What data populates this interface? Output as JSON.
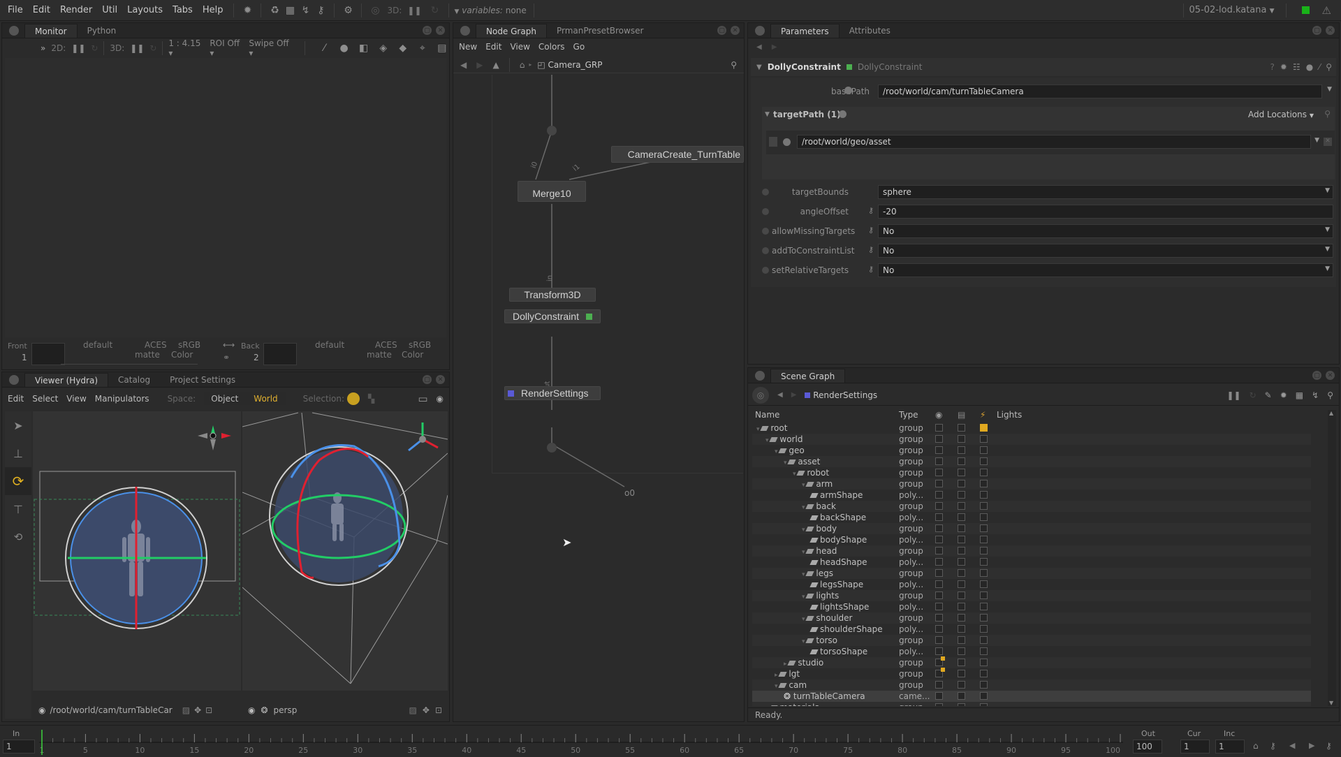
{
  "menubar": {
    "items": [
      "File",
      "Edit",
      "Render",
      "Util",
      "Layouts",
      "Tabs",
      "Help"
    ],
    "mode_3d": "3D:",
    "variables_label": "variables:",
    "variables_value": "none",
    "project_file": "05-02-lod.katana",
    "status_color": "#19b219"
  },
  "monitor": {
    "tabs": [
      "Monitor",
      "Python"
    ],
    "toolbar": {
      "mode_2d": "2D:",
      "mode_3d": "3D:",
      "zoom": "1 : 4.15",
      "roi": "ROI Off",
      "swipe": "Swipe Off"
    },
    "front": {
      "label": "Front",
      "index": "1",
      "channel": "default",
      "colorspace": "ACES",
      "display": "sRGB",
      "matte": "matte",
      "color": "Color"
    },
    "back": {
      "label": "Back",
      "index": "2",
      "channel": "default",
      "colorspace": "ACES",
      "display": "sRGB",
      "matte": "matte",
      "color": "Color"
    }
  },
  "viewer": {
    "tabs": [
      "Viewer (Hydra)",
      "Catalog",
      "Project Settings"
    ],
    "menu": [
      "Edit",
      "Select",
      "View",
      "Manipulators"
    ],
    "space_label": "Space:",
    "space_options": [
      "Object",
      "World"
    ],
    "space_selected": "World",
    "selection_label": "Selection:",
    "tools": [
      "select-tool",
      "translate-tool",
      "rotate-tool",
      "scale-tool",
      "transform-tool"
    ],
    "active_tool": "rotate-tool",
    "left_camera": "/root/world/cam/turnTableCar",
    "right_camera": "persp"
  },
  "node_graph": {
    "tabs": [
      "Node Graph",
      "PrmanPresetBrowser"
    ],
    "menu": [
      "New",
      "Edit",
      "View",
      "Colors",
      "Go"
    ],
    "breadcrumb": "Camera_GRP",
    "nodes": {
      "camera_create": "CameraCreate_TurnTable",
      "merge": "Merge10",
      "transform": "Transform3D",
      "dolly": "DollyConstraint",
      "render_settings": "RenderSettings"
    },
    "port_labels": {
      "merge_in0": "i0",
      "merge_in1": "i1",
      "transform_in": "in",
      "render_input": "input",
      "output": "o0"
    },
    "dolly_color": "#4caf50",
    "render_settings_color": "#5a5ad6"
  },
  "parameters": {
    "tabs": [
      "Parameters",
      "Attributes"
    ],
    "node_name": "DollyConstraint",
    "node_type": "DollyConstraint",
    "basePath": {
      "label": "basePath",
      "value": "/root/world/cam/turnTableCamera"
    },
    "targetPath": {
      "label": "targetPath (1)",
      "add_label": "Add Locations",
      "items": [
        "/root/world/geo/asset"
      ]
    },
    "fields": [
      {
        "label": "targetBounds",
        "value": "sphere"
      },
      {
        "label": "angleOffset",
        "value": "-20"
      },
      {
        "label": "allowMissingTargets",
        "value": "No"
      },
      {
        "label": "addToConstraintList",
        "value": "No"
      },
      {
        "label": "setRelativeTargets",
        "value": "No"
      }
    ]
  },
  "scene_graph": {
    "tab": "Scene Graph",
    "view_node": "RenderSettings",
    "columns": [
      "Name",
      "Type",
      "",
      "",
      "",
      "Lights"
    ],
    "rows": [
      {
        "name": "root",
        "type": "group",
        "depth": 0,
        "icon": "group"
      },
      {
        "name": "world",
        "type": "group",
        "depth": 1,
        "icon": "group"
      },
      {
        "name": "geo",
        "type": "group",
        "depth": 2,
        "icon": "group"
      },
      {
        "name": "asset",
        "type": "group",
        "depth": 3,
        "icon": "group"
      },
      {
        "name": "robot",
        "type": "group",
        "depth": 4,
        "icon": "group"
      },
      {
        "name": "arm",
        "type": "group",
        "depth": 5,
        "icon": "group"
      },
      {
        "name": "armShape",
        "type": "poly...",
        "depth": 6,
        "icon": "poly"
      },
      {
        "name": "back",
        "type": "group",
        "depth": 5,
        "icon": "group"
      },
      {
        "name": "backShape",
        "type": "poly...",
        "depth": 6,
        "icon": "poly"
      },
      {
        "name": "body",
        "type": "group",
        "depth": 5,
        "icon": "group"
      },
      {
        "name": "bodyShape",
        "type": "poly...",
        "depth": 6,
        "icon": "poly"
      },
      {
        "name": "head",
        "type": "group",
        "depth": 5,
        "icon": "group"
      },
      {
        "name": "headShape",
        "type": "poly...",
        "depth": 6,
        "icon": "poly"
      },
      {
        "name": "legs",
        "type": "group",
        "depth": 5,
        "icon": "group"
      },
      {
        "name": "legsShape",
        "type": "poly...",
        "depth": 6,
        "icon": "poly"
      },
      {
        "name": "lights",
        "type": "group",
        "depth": 5,
        "icon": "group"
      },
      {
        "name": "lightsShape",
        "type": "poly...",
        "depth": 6,
        "icon": "poly"
      },
      {
        "name": "shoulder",
        "type": "group",
        "depth": 5,
        "icon": "group"
      },
      {
        "name": "shoulderShape",
        "type": "poly...",
        "depth": 6,
        "icon": "poly"
      },
      {
        "name": "torso",
        "type": "group",
        "depth": 5,
        "icon": "group"
      },
      {
        "name": "torsoShape",
        "type": "poly...",
        "depth": 6,
        "icon": "poly"
      },
      {
        "name": "studio",
        "type": "group",
        "depth": 3,
        "icon": "group"
      },
      {
        "name": "lgt",
        "type": "group",
        "depth": 2,
        "icon": "group"
      },
      {
        "name": "cam",
        "type": "group",
        "depth": 2,
        "icon": "group"
      },
      {
        "name": "turnTableCamera",
        "type": "came...",
        "depth": 3,
        "icon": "camera",
        "selected": true
      },
      {
        "name": "materials",
        "type": "group",
        "depth": 1,
        "icon": "group"
      }
    ],
    "status": "Ready."
  },
  "timeline": {
    "in_label": "In",
    "in_value": "1",
    "out_label": "Out",
    "out_value": "100",
    "cur_label": "Cur",
    "cur_value": "1",
    "inc_label": "Inc",
    "inc_value": "1",
    "current_frame": 1,
    "range": [
      1,
      100
    ],
    "tick_labels": [
      "1",
      "5",
      "10",
      "15",
      "20",
      "25",
      "30",
      "35",
      "40",
      "45",
      "50",
      "55",
      "60",
      "65",
      "70",
      "75",
      "80",
      "85",
      "90",
      "95",
      "100"
    ]
  }
}
